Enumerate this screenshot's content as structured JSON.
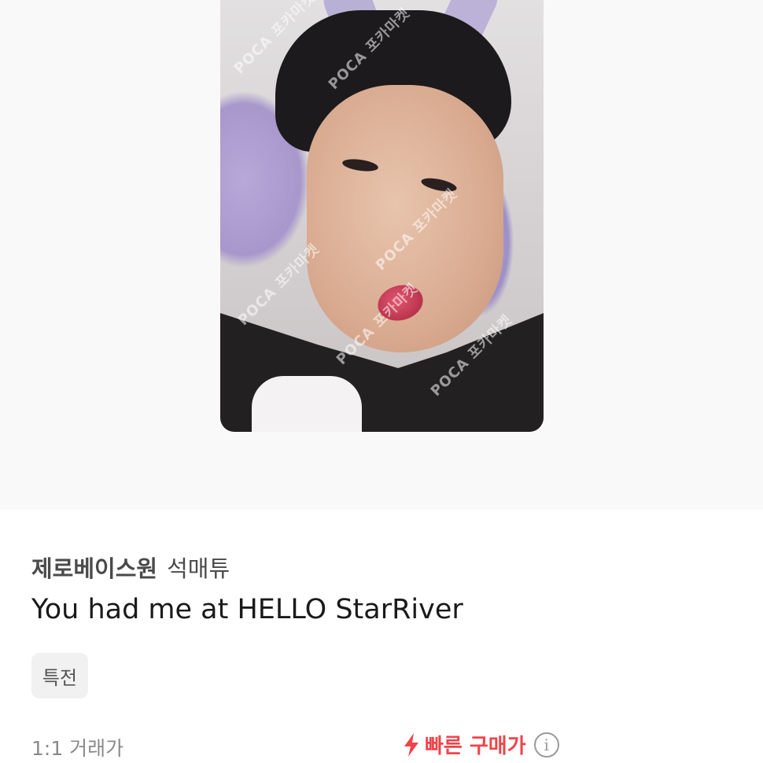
{
  "image": {
    "watermark_text": "POCA 포카마켓"
  },
  "product": {
    "artist": "제로베이스원",
    "member": "석매튜",
    "album": "You had me at HELLO StarRiver",
    "tag": "특전"
  },
  "price": {
    "trade_label": "1:1 거래가",
    "quick_buy_label": "빠른 구매가",
    "info_glyph": "i"
  },
  "colors": {
    "accent": "#f0444a",
    "text_primary": "#1a1a1a",
    "text_secondary": "#4a4a4a",
    "muted": "#8a8a8a",
    "hero_bg": "#f9f9f9"
  }
}
